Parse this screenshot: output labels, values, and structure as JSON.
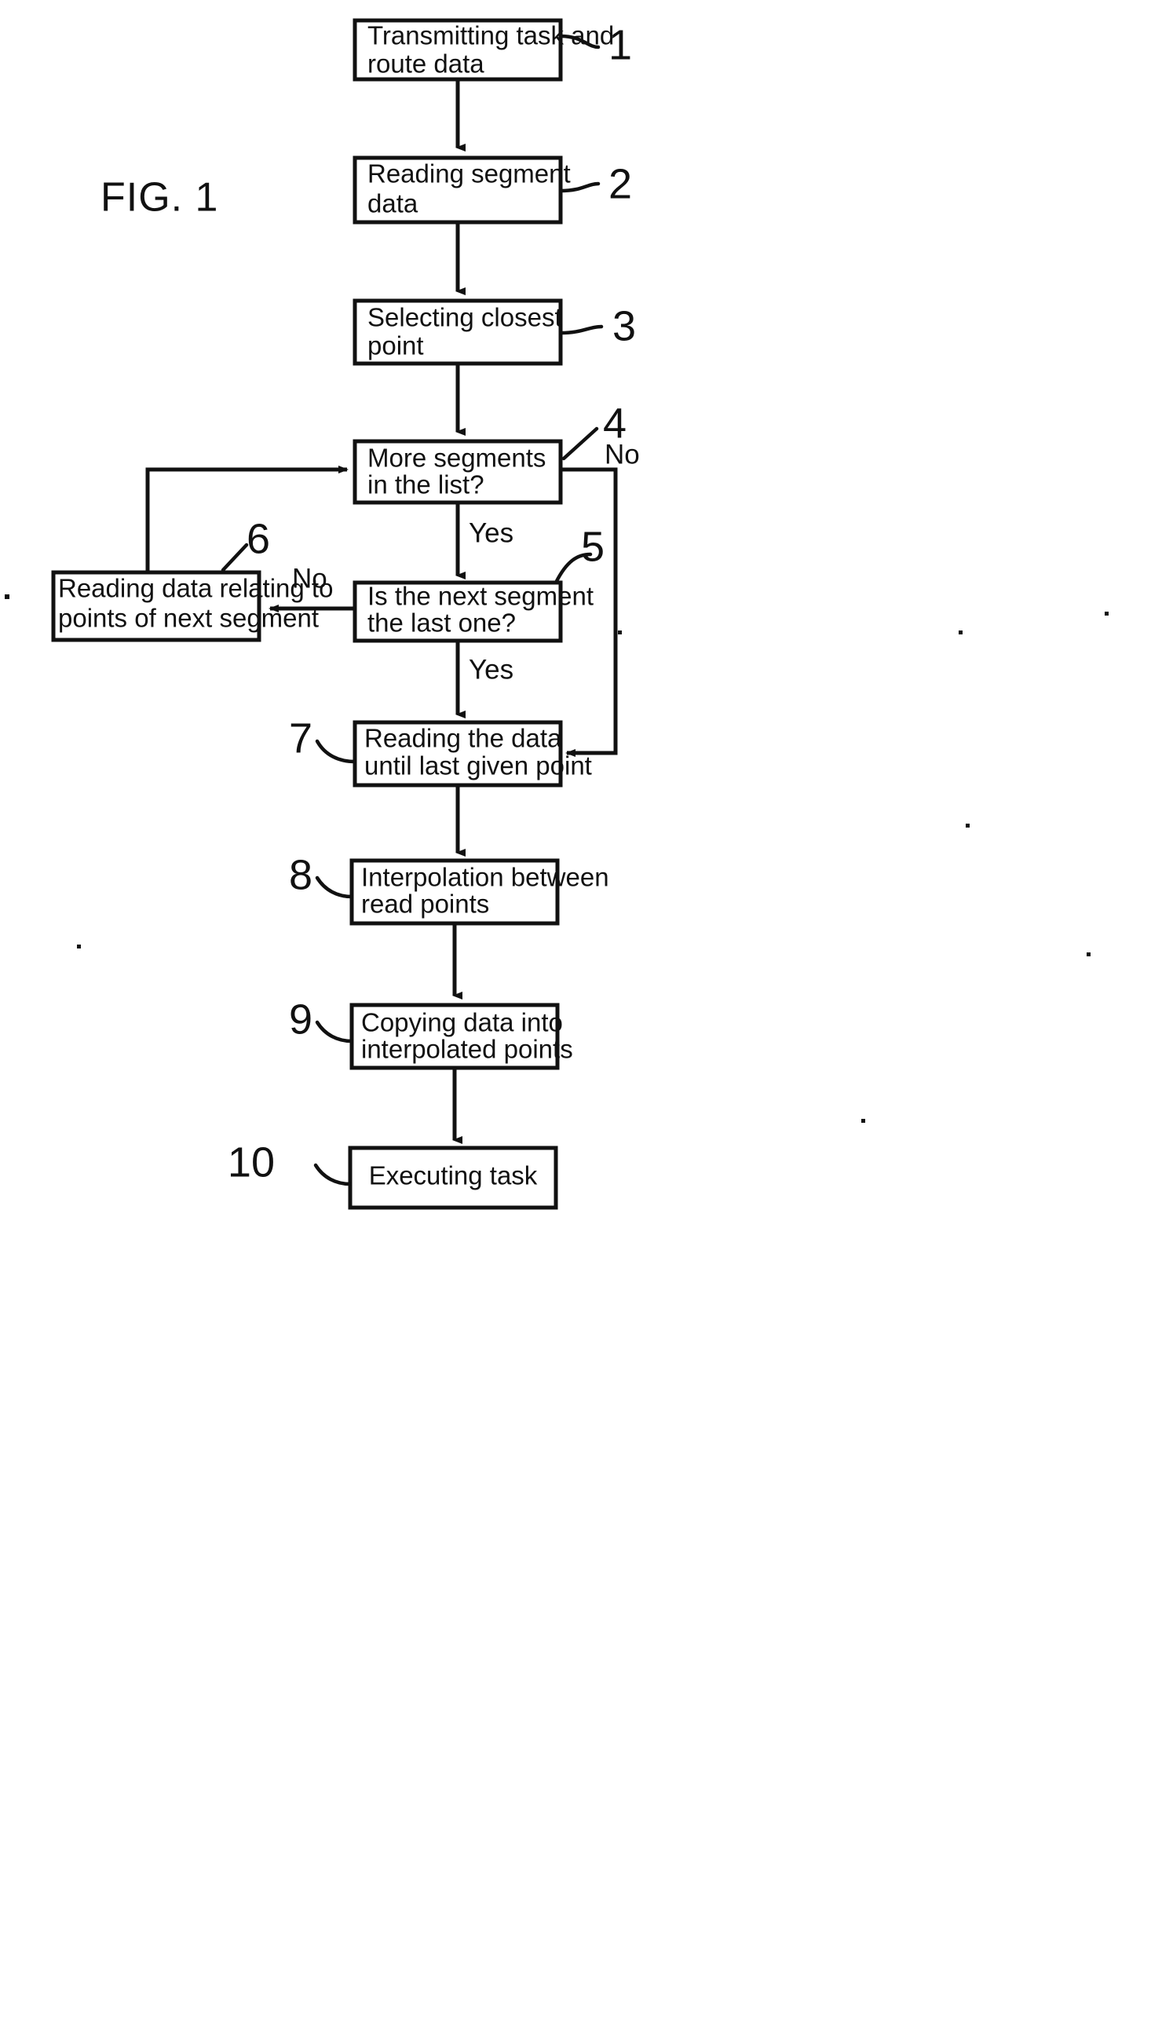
{
  "figure": {
    "label": "FIG. 1",
    "title": "FIG. 1"
  },
  "chart_data": {
    "type": "diagram",
    "title": "FIG. 1",
    "diagram_kind": "flowchart",
    "nodes": [
      {
        "ref": "1",
        "text": "Transmitting task and route data",
        "line1": "Transmitting task and",
        "line2": "route data"
      },
      {
        "ref": "2",
        "text": "Reading segment data",
        "line1": "Reading segment",
        "line2": "data"
      },
      {
        "ref": "3",
        "text": "Selecting closest point",
        "line1": "Selecting closest",
        "line2": "point"
      },
      {
        "ref": "4",
        "text": "More segments in the list?",
        "line1": "More segments",
        "line2": "in the list?"
      },
      {
        "ref": "5",
        "text": "Is the next segment the last one?",
        "line1": "Is the next segment",
        "line2": "the last one?"
      },
      {
        "ref": "6",
        "text": "Reading data relating to points of next segment",
        "line1": "Reading data relating to",
        "line2": "points of next segment"
      },
      {
        "ref": "7",
        "text": "Reading the data until last given point",
        "line1": "Reading the data",
        "line2": "until last given point"
      },
      {
        "ref": "8",
        "text": "Interpolation between read points",
        "line1": "Interpolation between",
        "line2": "read points"
      },
      {
        "ref": "9",
        "text": "Copying data into interpolated points",
        "line1": "Copying data into",
        "line2": "interpolated points"
      },
      {
        "ref": "10",
        "text": "Executing task",
        "line1": "Executing task",
        "line2": ""
      }
    ],
    "edges": [
      {
        "from": "1",
        "to": "2",
        "label": ""
      },
      {
        "from": "2",
        "to": "3",
        "label": ""
      },
      {
        "from": "3",
        "to": "4",
        "label": ""
      },
      {
        "from": "4",
        "to": "5",
        "label": "Yes"
      },
      {
        "from": "4",
        "to": "7",
        "label": "No"
      },
      {
        "from": "5",
        "to": "6",
        "label": "No"
      },
      {
        "from": "5",
        "to": "7",
        "label": "Yes"
      },
      {
        "from": "6",
        "to": "4",
        "label": ""
      },
      {
        "from": "7",
        "to": "8",
        "label": ""
      },
      {
        "from": "8",
        "to": "9",
        "label": ""
      },
      {
        "from": "9",
        "to": "10",
        "label": ""
      }
    ],
    "edge_labels": {
      "yes_from_4": "Yes",
      "no_from_4": "No",
      "no_from_5": "No",
      "yes_from_5": "Yes"
    },
    "colors": {
      "ink": "#111111",
      "paper": "#ffffff"
    }
  }
}
